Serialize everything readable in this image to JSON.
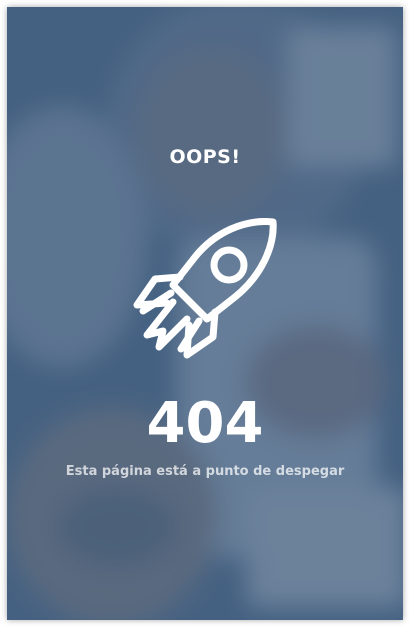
{
  "error_page": {
    "heading": "OOPS!",
    "code": "404",
    "message": "Esta página está a punto de despegar",
    "icon": "rocket-icon",
    "overlay_color": "#3e5c7d",
    "text_color": "#ffffff"
  }
}
